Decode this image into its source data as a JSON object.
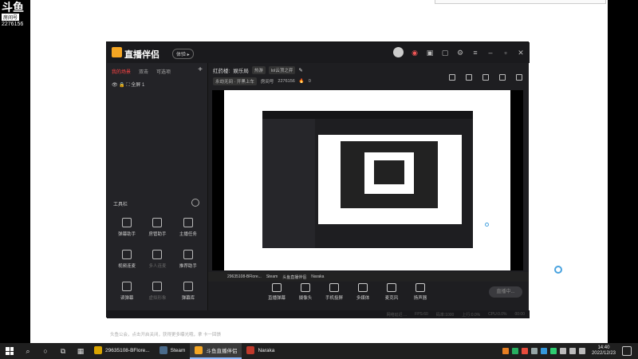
{
  "watermark": {
    "logo": "斗鱼",
    "sub": "房间号",
    "room_id": "2276156"
  },
  "app": {
    "title": "直播伴侣",
    "beta_label": "体验 ▸",
    "left_panel": {
      "tabs": [
        "我的场景",
        "双击",
        "可选项"
      ],
      "scene_name": "全屏 1",
      "tools_title": "工具栏",
      "tools": [
        {
          "label": "弹幕助手",
          "enabled": true
        },
        {
          "label": "房管助手",
          "enabled": true
        },
        {
          "label": "主播任务",
          "enabled": true
        },
        {
          "label": "视频连麦",
          "enabled": true
        },
        {
          "label": "多人连麦",
          "enabled": false
        },
        {
          "label": "推荐助手",
          "enabled": true
        },
        {
          "label": "读弹幕",
          "enabled": true
        },
        {
          "label": "虚拟形象",
          "enabled": false
        },
        {
          "label": "弹幕库",
          "enabled": true
        }
      ],
      "hint": "头鱼公会，点击开启关闭，获得更多曝光哦，拿 卡一回馈"
    },
    "stream_info": {
      "title_prefix": "红药楼:",
      "category": "娱乐局",
      "tag1": "热游",
      "tag2": "lol云顶之弈",
      "subtitle": "永劫无间 · 开黑上车",
      "room_label": "房间号",
      "room_id": "2276156",
      "heat": "0"
    },
    "bottom_buttons": [
      "直播弹幕",
      "摄像头",
      "手机投屏",
      "多媒体",
      "麦克风",
      "扬声器"
    ],
    "go_live_label": "直播中...",
    "status": [
      "网络延迟 ...",
      "FPS:60",
      "码率:1000",
      "上行:0.0%",
      "CPU:0.0%",
      "00:00"
    ]
  },
  "inner_taskbar": [
    "29635108-BFlore...",
    "Steam",
    "头鱼直播伴侣",
    "Naraka"
  ],
  "taskbar": {
    "apps": [
      {
        "label": "29635108-BFlore...",
        "color": "#d9a400",
        "active": false
      },
      {
        "label": "Steam",
        "color": "#1b2838",
        "active": false
      },
      {
        "label": "斗鱼直播伴侣",
        "color": "#f5a623",
        "active": true
      },
      {
        "label": "Naraka",
        "color": "#c0392b",
        "active": false
      }
    ],
    "time": "14:40",
    "date": "2022/12/23"
  }
}
